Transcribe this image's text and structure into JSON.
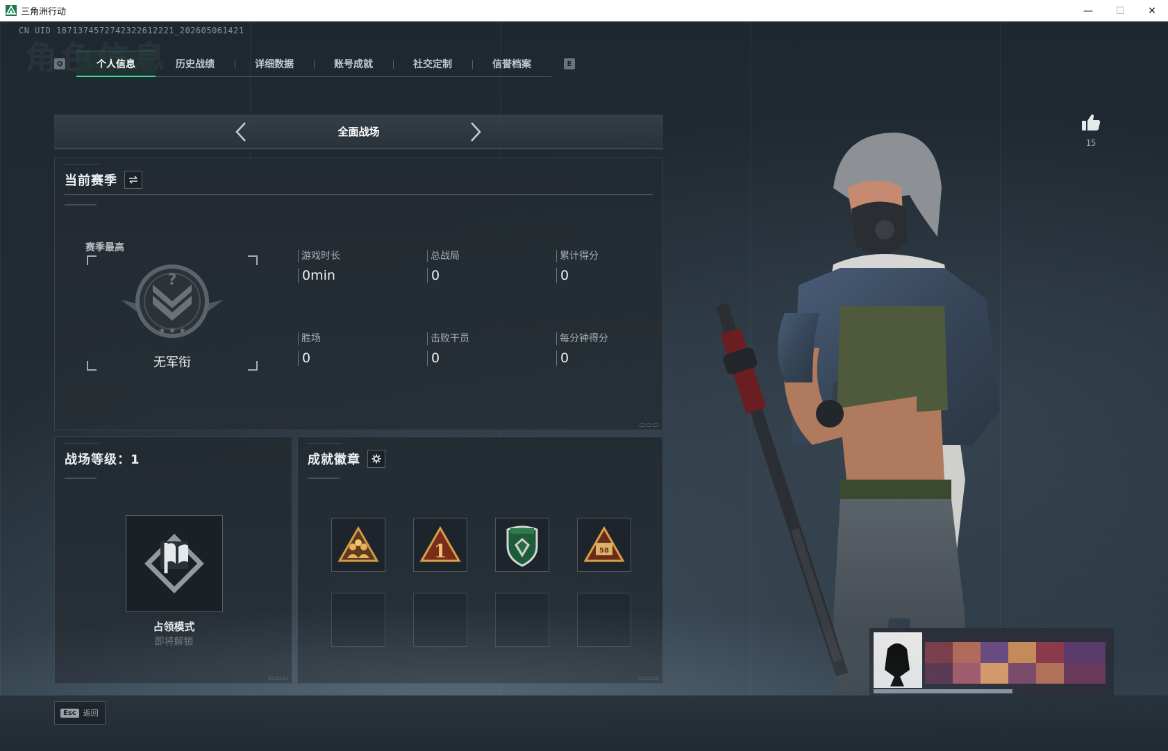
{
  "window": {
    "title": "三角洲行动"
  },
  "uid": "CN UID 1871374572742322612221_202605061421",
  "watermark": "角色信息",
  "tabs": {
    "left_key": "Q",
    "right_key": "E",
    "items": [
      {
        "label": "个人信息",
        "active": true
      },
      {
        "label": "历史战绩",
        "active": false
      },
      {
        "label": "详细数据",
        "active": false
      },
      {
        "label": "账号成就",
        "active": false
      },
      {
        "label": "社交定制",
        "active": false
      },
      {
        "label": "信誉档案",
        "active": false
      }
    ]
  },
  "mode_selector": {
    "title": "全面战场"
  },
  "season": {
    "title": "当前赛季",
    "rank_label": "赛季最高",
    "rank_name": "无军衔",
    "stats": [
      {
        "label": "游戏时长",
        "value": "0min"
      },
      {
        "label": "总战局",
        "value": "0"
      },
      {
        "label": "累计得分",
        "value": "0"
      },
      {
        "label": "胜场",
        "value": "0"
      },
      {
        "label": "击败干员",
        "value": "0"
      },
      {
        "label": "每分钟得分",
        "value": "0"
      }
    ]
  },
  "level": {
    "title": "战场等级：1",
    "mode_name": "占领模式",
    "mode_status": "即将解锁"
  },
  "achievements": {
    "title": "成就徽章",
    "badges": [
      "squad-badge-icon",
      "rank-one-badge-icon",
      "shield-emblem-badge-icon",
      "sign-badge-icon"
    ],
    "badge_sign_text": "58",
    "badge_one_text": "1"
  },
  "like": {
    "count": "15"
  },
  "bottom": {
    "esc_key": "Esc",
    "esc_label": "返回"
  },
  "colors": {
    "accent": "#3fd89d",
    "panel": "#232b32",
    "text": "#eef1f3"
  }
}
